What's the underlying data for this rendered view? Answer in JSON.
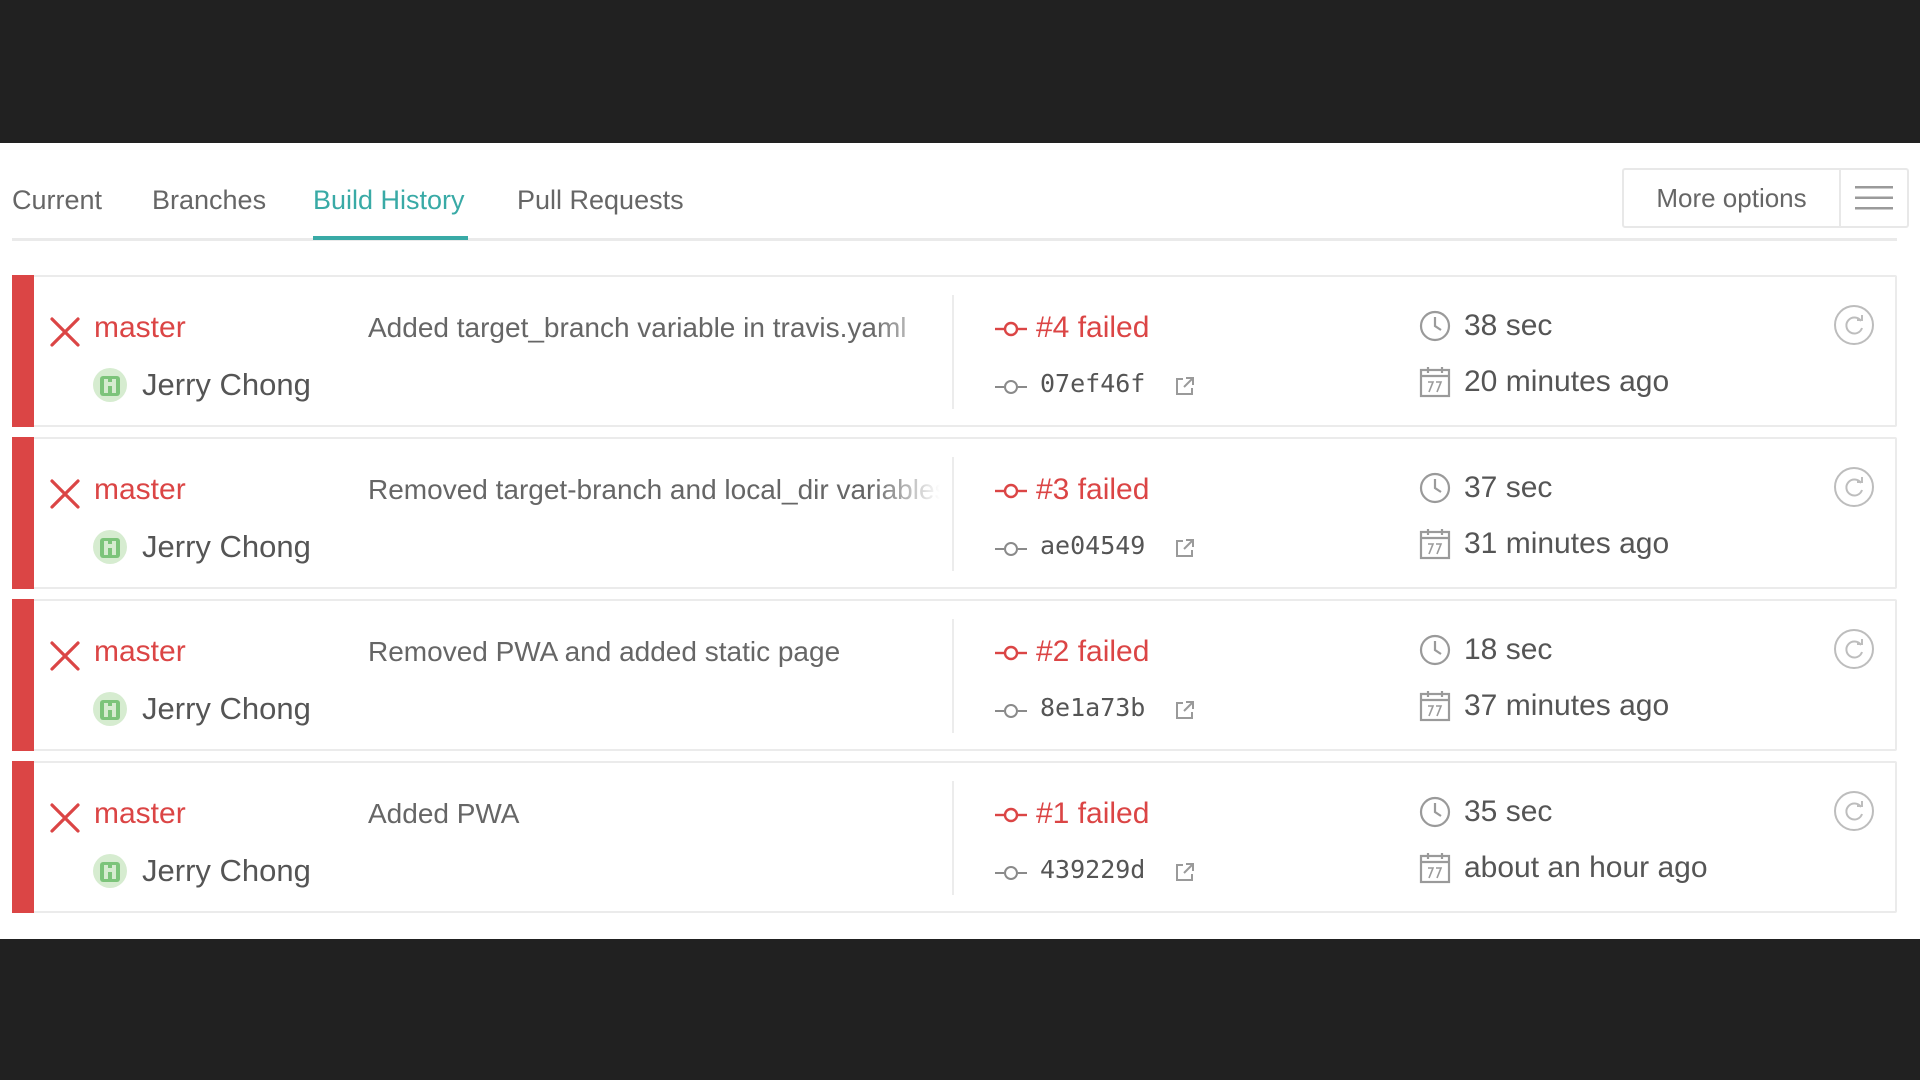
{
  "tabs": [
    {
      "label": "Current",
      "active": false
    },
    {
      "label": "Branches",
      "active": false
    },
    {
      "label": "Build History",
      "active": true
    },
    {
      "label": "Pull Requests",
      "active": false
    }
  ],
  "more_options": {
    "label": "More options",
    "icon": "hamburger-menu-icon"
  },
  "colors": {
    "failed": "#db4545",
    "accent": "#39aaa6",
    "text": "#555555"
  },
  "builds": [
    {
      "branch": "master",
      "author": "Jerry Chong",
      "message": "Added target_branch variable in travis.yaml",
      "build": "#4 failed",
      "commit": "07ef46f",
      "duration": "38 sec",
      "finished": "20 minutes ago"
    },
    {
      "branch": "master",
      "author": "Jerry Chong",
      "message": "Removed target-branch and local_dir variables",
      "build": "#3 failed",
      "commit": "ae04549",
      "duration": "37 sec",
      "finished": "31 minutes ago"
    },
    {
      "branch": "master",
      "author": "Jerry Chong",
      "message": "Removed PWA and added static page",
      "build": "#2 failed",
      "commit": "8e1a73b",
      "duration": "18 sec",
      "finished": "37 minutes ago"
    },
    {
      "branch": "master",
      "author": "Jerry Chong",
      "message": "Added PWA",
      "build": "#1 failed",
      "commit": "439229d",
      "duration": "35 sec",
      "finished": "about an hour ago"
    }
  ]
}
